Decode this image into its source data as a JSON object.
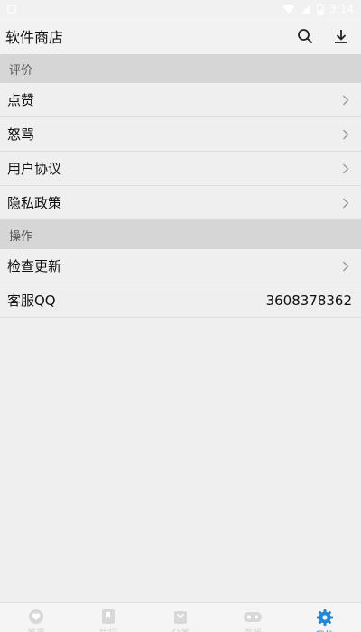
{
  "status_bar": {
    "time": "3:14"
  },
  "app_bar": {
    "title": "软件商店",
    "icons": [
      "search-icon",
      "download-icon"
    ]
  },
  "sections": [
    {
      "header": "评价",
      "rows": [
        {
          "label": "点赞",
          "chevron": true
        },
        {
          "label": "怒骂",
          "chevron": true
        },
        {
          "label": "用户协议",
          "chevron": true
        },
        {
          "label": "隐私政策",
          "chevron": true
        }
      ]
    },
    {
      "header": "操作",
      "rows": [
        {
          "label": "检查更新",
          "chevron": true
        },
        {
          "label": "客服QQ",
          "value": "3608378362"
        }
      ]
    }
  ],
  "bottom_nav": {
    "items": [
      {
        "label": "首页",
        "icon": "heart-icon"
      },
      {
        "label": "排行",
        "icon": "bookmark-icon"
      },
      {
        "label": "分类",
        "icon": "bag-icon"
      },
      {
        "label": "游戏",
        "icon": "gamepad-icon"
      },
      {
        "label": "我的",
        "icon": "gear-icon",
        "active": true
      }
    ],
    "active_color": "#1f88d8",
    "inactive_color": "#cfcfcf"
  }
}
